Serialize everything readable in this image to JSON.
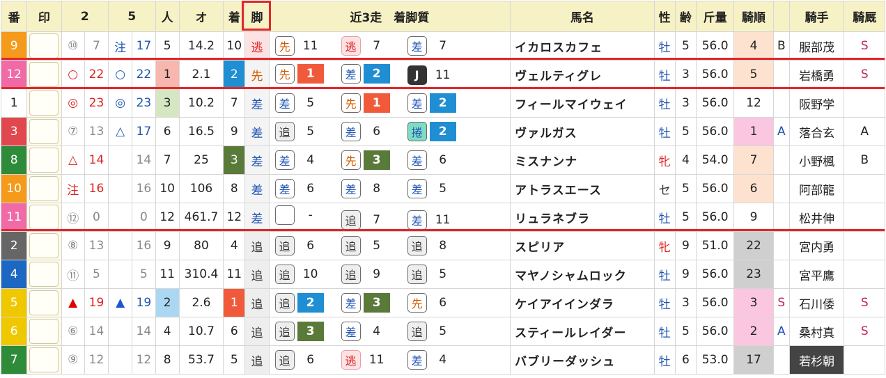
{
  "headers": {
    "ban": "番",
    "mark": "印",
    "c2": "2",
    "c5": "5",
    "pop": "人",
    "odds": "オ",
    "finish": "着",
    "style": "脚",
    "recent": "近3走　着脚質",
    "name": "馬名",
    "sex": "性",
    "age": "齢",
    "weight": "斤量",
    "rank": "騎順",
    "jockey": "騎手",
    "stable": "騎厩"
  },
  "colors": {
    "header_bg": "#f6f2c6",
    "mark_bg": "#fffbe9",
    "separator": "#e3262b",
    "finish_blue": "#1f8ed2",
    "finish_green": "#5a7a3a",
    "finish_red": "#f05a3a",
    "frame_orange": "#f59a1a",
    "frame_pink": "#f06aa8",
    "frame_white": "#ffffff",
    "frame_red": "#e0474e",
    "frame_green": "#2e8b3a",
    "frame_gray": "#666666",
    "frame_blue": "#1c67c2",
    "frame_yellow": "#f0c800"
  },
  "rows": [
    {
      "ban": "9",
      "ban_bg": "#f59a1a",
      "ban_fg": "#ffffff",
      "m2": "⑩",
      "m2c": "#888",
      "n2": "7",
      "n2c": "#888",
      "m5": "注",
      "m5c": "#1f55b3",
      "n5": "17",
      "n5c": "#1f55b3",
      "pop": "5",
      "pop_bg": "",
      "odds": "14.2",
      "fin": "10",
      "fin_bg": "",
      "fin_fg": "#222",
      "style": "逃",
      "style_c": "#d22",
      "style_bg": "#fde2e4",
      "recent": [
        {
          "k": "先",
          "cls": "c-sen",
          "v": "11",
          "bg": ""
        },
        {
          "k": "逃",
          "cls": "c-nige",
          "v": "7",
          "bg": ""
        },
        {
          "k": "差",
          "cls": "c-sashi",
          "v": "7",
          "bg": ""
        }
      ],
      "name": "イカロスカフェ",
      "sex": "牡",
      "sexc": "sex-m",
      "age": "5",
      "wt": "56.0",
      "rank": "4",
      "rank_bg": "#fde2cf",
      "ritem": "B",
      "ritemc": "#222",
      "jockey": "服部茂",
      "jbg": "",
      "jfg": "#222",
      "stable": "S",
      "stablec": "#c0245a"
    },
    {
      "ban": "12",
      "ban_bg": "#f06aa8",
      "ban_fg": "#ffffff",
      "m2": "○",
      "m2c": "#d22",
      "n2": "22",
      "n2c": "#d22",
      "m5": "○",
      "m5c": "#1f55b3",
      "n5": "22",
      "n5c": "#1f55b3",
      "pop": "1",
      "pop_bg": "#f7b7ae",
      "odds": "2.1",
      "fin": "2",
      "fin_bg": "#1f8ed2",
      "fin_fg": "#ffffff",
      "style": "先",
      "style_c": "#d05a00",
      "style_bg": "",
      "recent": [
        {
          "k": "先",
          "cls": "c-sen",
          "v": "1",
          "bg": "#f05a3a"
        },
        {
          "k": "差",
          "cls": "c-sashi",
          "v": "2",
          "bg": "#1f8ed2"
        },
        {
          "k": "J",
          "cls": "c-j",
          "v": "11",
          "bg": ""
        }
      ],
      "name": "ヴェルティグレ",
      "sex": "牡",
      "sexc": "sex-m",
      "age": "3",
      "wt": "56.0",
      "rank": "5",
      "rank_bg": "#fde2cf",
      "ritem": "",
      "ritemc": "#222",
      "jockey": "岩橋勇",
      "jbg": "",
      "jfg": "#222",
      "stable": "S",
      "stablec": "#c0245a"
    },
    {
      "ban": "1",
      "ban_bg": "#ffffff",
      "ban_fg": "#222222",
      "m2": "◎",
      "m2c": "#d22",
      "n2": "23",
      "n2c": "#d22",
      "m5": "◎",
      "m5c": "#1f55b3",
      "n5": "23",
      "n5c": "#1f55b3",
      "pop": "3",
      "pop_bg": "#d5e6c3",
      "odds": "10.2",
      "fin": "7",
      "fin_bg": "",
      "fin_fg": "#222",
      "style": "差",
      "style_c": "#1f55b3",
      "style_bg": "",
      "recent": [
        {
          "k": "差",
          "cls": "c-sashi",
          "v": "5",
          "bg": ""
        },
        {
          "k": "先",
          "cls": "c-sen",
          "v": "1",
          "bg": "#f05a3a"
        },
        {
          "k": "差",
          "cls": "c-sashi",
          "v": "2",
          "bg": "#1f8ed2"
        }
      ],
      "name": "フィールマイウェイ",
      "sex": "牡",
      "sexc": "sex-m",
      "age": "3",
      "wt": "56.0",
      "rank": "12",
      "rank_bg": "",
      "ritem": "",
      "ritemc": "#222",
      "jockey": "阪野学",
      "jbg": "",
      "jfg": "#222",
      "stable": "",
      "stablec": "#222"
    },
    {
      "ban": "3",
      "ban_bg": "#e0474e",
      "ban_fg": "#ffffff",
      "m2": "⑦",
      "m2c": "#888",
      "n2": "13",
      "n2c": "#888",
      "m5": "△",
      "m5c": "#1f55b3",
      "n5": "17",
      "n5c": "#1f55b3",
      "pop": "6",
      "pop_bg": "",
      "odds": "16.5",
      "fin": "9",
      "fin_bg": "",
      "fin_fg": "#222",
      "style": "差",
      "style_c": "#1f55b3",
      "style_bg": "",
      "recent": [
        {
          "k": "追",
          "cls": "c-oi",
          "v": "5",
          "bg": ""
        },
        {
          "k": "差",
          "cls": "c-sashi",
          "v": "6",
          "bg": ""
        },
        {
          "k": "捲",
          "cls": "c-maki",
          "v": "2",
          "bg": "#1f8ed2"
        }
      ],
      "name": "ヴァルガス",
      "sex": "牡",
      "sexc": "sex-m",
      "age": "5",
      "wt": "56.0",
      "rank": "1",
      "rank_bg": "#fbc6e0",
      "ritem": "A",
      "ritemc": "#1f55b3",
      "jockey": "落合玄",
      "jbg": "",
      "jfg": "#222",
      "stable": "A",
      "stablec": "#222"
    },
    {
      "ban": "8",
      "ban_bg": "#2e8b3a",
      "ban_fg": "#ffffff",
      "m2": "△",
      "m2c": "#d22",
      "n2": "14",
      "n2c": "#d22",
      "m5": "",
      "m5c": "#888",
      "n5": "14",
      "n5c": "#888",
      "pop": "7",
      "pop_bg": "",
      "odds": "25",
      "fin": "3",
      "fin_bg": "#5a7a3a",
      "fin_fg": "#ffffff",
      "style": "差",
      "style_c": "#1f55b3",
      "style_bg": "",
      "recent": [
        {
          "k": "差",
          "cls": "c-sashi",
          "v": "4",
          "bg": ""
        },
        {
          "k": "先",
          "cls": "c-sen",
          "v": "3",
          "bg": "#5a7a3a"
        },
        {
          "k": "差",
          "cls": "c-sashi",
          "v": "6",
          "bg": ""
        }
      ],
      "name": "ミスナンナ",
      "sex": "牝",
      "sexc": "sex-f",
      "age": "4",
      "wt": "54.0",
      "rank": "7",
      "rank_bg": "#fde2cf",
      "ritem": "",
      "ritemc": "#222",
      "jockey": "小野楓",
      "jbg": "",
      "jfg": "#222",
      "stable": "B",
      "stablec": "#222"
    },
    {
      "ban": "10",
      "ban_bg": "#f59a1a",
      "ban_fg": "#ffffff",
      "m2": "注",
      "m2c": "#d22",
      "n2": "16",
      "n2c": "#d22",
      "m5": "",
      "m5c": "#888",
      "n5": "16",
      "n5c": "#888",
      "pop": "10",
      "pop_bg": "",
      "odds": "106",
      "fin": "8",
      "fin_bg": "",
      "fin_fg": "#222",
      "style": "差",
      "style_c": "#1f55b3",
      "style_bg": "",
      "recent": [
        {
          "k": "差",
          "cls": "c-sashi",
          "v": "6",
          "bg": ""
        },
        {
          "k": "差",
          "cls": "c-sashi",
          "v": "8",
          "bg": ""
        },
        {
          "k": "差",
          "cls": "c-sashi",
          "v": "5",
          "bg": ""
        }
      ],
      "name": "アトラスエース",
      "sex": "セ",
      "sexc": "sex-g",
      "age": "5",
      "wt": "56.0",
      "rank": "6",
      "rank_bg": "#fde2cf",
      "ritem": "",
      "ritemc": "#222",
      "jockey": "阿部龍",
      "jbg": "",
      "jfg": "#222",
      "stable": "",
      "stablec": "#222"
    },
    {
      "ban": "11",
      "ban_bg": "#f06aa8",
      "ban_fg": "#ffffff",
      "m2": "⑫",
      "m2c": "#888",
      "n2": "0",
      "n2c": "#888",
      "m5": "",
      "m5c": "#888",
      "n5": "0",
      "n5c": "#888",
      "pop": "12",
      "pop_bg": "",
      "odds": "461.7",
      "fin": "12",
      "fin_bg": "",
      "fin_fg": "#222",
      "style": "差",
      "style_c": "#1f55b3",
      "style_bg": "",
      "recent": [
        {
          "k": "",
          "cls": "c-none",
          "v": "-",
          "bg": ""
        },
        {
          "k": "追",
          "cls": "c-oi",
          "v": "7",
          "bg": ""
        },
        {
          "k": "差",
          "cls": "c-sashi",
          "v": "11",
          "bg": ""
        }
      ],
      "name": "リュラネブラ",
      "sex": "牡",
      "sexc": "sex-m",
      "age": "5",
      "wt": "56.0",
      "rank": "9",
      "rank_bg": "",
      "ritem": "",
      "ritemc": "#222",
      "jockey": "松井伸",
      "jbg": "",
      "jfg": "#222",
      "stable": "",
      "stablec": "#222"
    },
    {
      "ban": "2",
      "ban_bg": "#666666",
      "ban_fg": "#ffffff",
      "m2": "⑧",
      "m2c": "#888",
      "n2": "13",
      "n2c": "#888",
      "m5": "",
      "m5c": "#888",
      "n5": "16",
      "n5c": "#888",
      "pop": "9",
      "pop_bg": "",
      "odds": "80",
      "fin": "4",
      "fin_bg": "",
      "fin_fg": "#222",
      "style": "追",
      "style_c": "#333",
      "style_bg": "#eeeeee",
      "recent": [
        {
          "k": "追",
          "cls": "c-oi",
          "v": "6",
          "bg": ""
        },
        {
          "k": "追",
          "cls": "c-oi",
          "v": "5",
          "bg": ""
        },
        {
          "k": "追",
          "cls": "c-oi",
          "v": "8",
          "bg": ""
        }
      ],
      "name": "スピリア",
      "sex": "牝",
      "sexc": "sex-f",
      "age": "9",
      "wt": "51.0",
      "rank": "22",
      "rank_bg": "#cfcfcf",
      "ritem": "",
      "ritemc": "#222",
      "jockey": "宮内勇",
      "jbg": "",
      "jfg": "#222",
      "stable": "",
      "stablec": "#222"
    },
    {
      "ban": "4",
      "ban_bg": "#1c67c2",
      "ban_fg": "#ffffff",
      "m2": "⑪",
      "m2c": "#888",
      "n2": "5",
      "n2c": "#888",
      "m5": "",
      "m5c": "#888",
      "n5": "5",
      "n5c": "#888",
      "pop": "11",
      "pop_bg": "",
      "odds": "310.4",
      "fin": "11",
      "fin_bg": "",
      "fin_fg": "#222",
      "style": "追",
      "style_c": "#333",
      "style_bg": "#eeeeee",
      "recent": [
        {
          "k": "追",
          "cls": "c-oi",
          "v": "10",
          "bg": ""
        },
        {
          "k": "追",
          "cls": "c-oi",
          "v": "9",
          "bg": ""
        },
        {
          "k": "追",
          "cls": "c-oi",
          "v": "5",
          "bg": ""
        }
      ],
      "name": "マヤノシャムロック",
      "sex": "牡",
      "sexc": "sex-m",
      "age": "9",
      "wt": "56.0",
      "rank": "23",
      "rank_bg": "#cfcfcf",
      "ritem": "",
      "ritemc": "#222",
      "jockey": "宮平鷹",
      "jbg": "",
      "jfg": "#222",
      "stable": "",
      "stablec": "#222"
    },
    {
      "ban": "5",
      "ban_bg": "#f0c800",
      "ban_fg": "#ffffff",
      "m2": "▲",
      "m2c": "#e00000",
      "n2": "19",
      "n2c": "#d22",
      "m5": "▲",
      "m5c": "#1f55d3",
      "n5": "19",
      "n5c": "#1f55b3",
      "pop": "2",
      "pop_bg": "#aad8f2",
      "odds": "2.6",
      "fin": "1",
      "fin_bg": "#f05a3a",
      "fin_fg": "#ffffff",
      "style": "追",
      "style_c": "#333",
      "style_bg": "#eeeeee",
      "recent": [
        {
          "k": "追",
          "cls": "c-oi",
          "v": "2",
          "bg": "#1f8ed2"
        },
        {
          "k": "差",
          "cls": "c-sashi",
          "v": "3",
          "bg": "#5a7a3a"
        },
        {
          "k": "先",
          "cls": "c-sen",
          "v": "6",
          "bg": ""
        }
      ],
      "name": "ケイアイインダラ",
      "sex": "牡",
      "sexc": "sex-m",
      "age": "3",
      "wt": "56.0",
      "rank": "3",
      "rank_bg": "#fbc6e0",
      "ritem": "S",
      "ritemc": "#c0245a",
      "jockey": "石川倭",
      "jbg": "",
      "jfg": "#222",
      "stable": "S",
      "stablec": "#c0245a"
    },
    {
      "ban": "6",
      "ban_bg": "#f0c800",
      "ban_fg": "#ffffff",
      "m2": "⑥",
      "m2c": "#888",
      "n2": "14",
      "n2c": "#888",
      "m5": "",
      "m5c": "#888",
      "n5": "14",
      "n5c": "#888",
      "pop": "4",
      "pop_bg": "",
      "odds": "10.7",
      "fin": "6",
      "fin_bg": "",
      "fin_fg": "#222",
      "style": "追",
      "style_c": "#333",
      "style_bg": "#eeeeee",
      "recent": [
        {
          "k": "追",
          "cls": "c-oi",
          "v": "3",
          "bg": "#5a7a3a"
        },
        {
          "k": "差",
          "cls": "c-sashi",
          "v": "4",
          "bg": ""
        },
        {
          "k": "追",
          "cls": "c-oi",
          "v": "5",
          "bg": ""
        }
      ],
      "name": "スティールレイダー",
      "sex": "牡",
      "sexc": "sex-m",
      "age": "5",
      "wt": "56.0",
      "rank": "2",
      "rank_bg": "#fbc6e0",
      "ritem": "A",
      "ritemc": "#1f55b3",
      "jockey": "桑村真",
      "jbg": "",
      "jfg": "#222",
      "stable": "S",
      "stablec": "#c0245a"
    },
    {
      "ban": "7",
      "ban_bg": "#2e8b3a",
      "ban_fg": "#ffffff",
      "m2": "⑨",
      "m2c": "#888",
      "n2": "12",
      "n2c": "#888",
      "m5": "",
      "m5c": "#888",
      "n5": "12",
      "n5c": "#888",
      "pop": "8",
      "pop_bg": "",
      "odds": "53.7",
      "fin": "5",
      "fin_bg": "",
      "fin_fg": "#222",
      "style": "追",
      "style_c": "#333",
      "style_bg": "#eeeeee",
      "recent": [
        {
          "k": "追",
          "cls": "c-oi",
          "v": "6",
          "bg": ""
        },
        {
          "k": "逃",
          "cls": "c-nige",
          "v": "11",
          "bg": ""
        },
        {
          "k": "差",
          "cls": "c-sashi",
          "v": "4",
          "bg": ""
        }
      ],
      "name": "バブリーダッシュ",
      "sex": "牡",
      "sexc": "sex-m",
      "age": "6",
      "wt": "53.0",
      "rank": "17",
      "rank_bg": "#cfcfcf",
      "ritem": "",
      "ritemc": "#222",
      "jockey": "若杉朝",
      "jbg": "#444444",
      "jfg": "#ffffff",
      "stable": "",
      "stablec": "#222"
    }
  ]
}
